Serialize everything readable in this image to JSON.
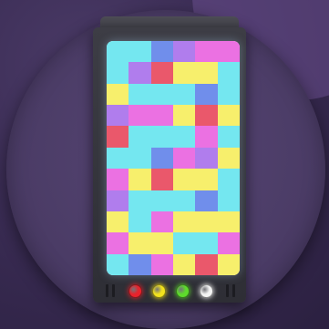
{
  "game": {
    "board": {
      "rows": [
        [
          "cyan",
          "cyan",
          "blue",
          "purple",
          "magenta",
          "magenta"
        ],
        [
          "cyan",
          "purple",
          "red",
          "yellow",
          "yellow",
          "cyan"
        ],
        [
          "yellow",
          "cyan",
          "cyan",
          "cyan",
          "blue",
          "cyan"
        ],
        [
          "purple",
          "magenta",
          "magenta",
          "yellow",
          "red",
          "yellow"
        ],
        [
          "red",
          "cyan",
          "cyan",
          "cyan",
          "magenta",
          "cyan"
        ],
        [
          "cyan",
          "cyan",
          "blue",
          "magenta",
          "purple",
          "yellow"
        ],
        [
          "magenta",
          "yellow",
          "red",
          "yellow",
          "yellow",
          "cyan"
        ],
        [
          "purple",
          "cyan",
          "cyan",
          "cyan",
          "blue",
          "cyan"
        ],
        [
          "yellow",
          "cyan",
          "magenta",
          "yellow",
          "yellow",
          "yellow"
        ],
        [
          "magenta",
          "yellow",
          "yellow",
          "cyan",
          "cyan",
          "magenta"
        ],
        [
          "cyan",
          "blue",
          "magenta",
          "yellow",
          "red",
          "yellow"
        ]
      ]
    },
    "palette": {
      "cyan": "#6fe8f2",
      "magenta": "#f06fe6",
      "yellow": "#f8ef66",
      "blue": "#6e8ef0",
      "purple": "#b27cf2",
      "red": "#f0566a"
    },
    "indicator_lights": [
      {
        "name": "red-light-icon",
        "color": "#e8232c"
      },
      {
        "name": "yellow-light-icon",
        "color": "#f2e21e"
      },
      {
        "name": "green-light-icon",
        "color": "#5edb2c"
      },
      {
        "name": "white-light-icon",
        "color": "#f4f4f4"
      }
    ],
    "colors": {
      "background": "#3a2c54",
      "disc": "#4b3c66",
      "device": "#38383f"
    }
  }
}
